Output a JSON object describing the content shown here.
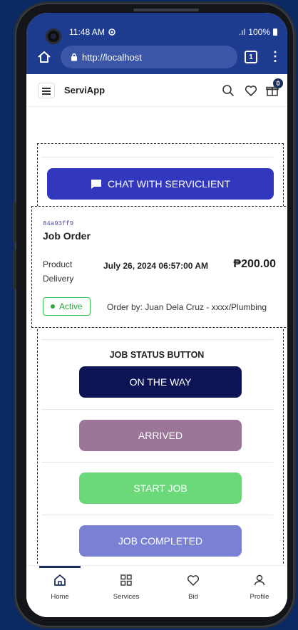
{
  "status_bar": {
    "time": "11:48 AM",
    "signal": ".ıl",
    "battery": "100%"
  },
  "browser": {
    "url": "http://localhost",
    "tab_count": "1"
  },
  "app": {
    "name": "ServiApp",
    "cart_count": "0"
  },
  "chat_button": {
    "label": "CHAT WITH SERVICLIENT"
  },
  "order": {
    "id": "84a93ff9",
    "title": "Job Order",
    "label_product": "Product",
    "label_delivery": "Delivery",
    "date": "July 26, 2024 06:57:00 AM",
    "price": "₱200.00",
    "status": "Active",
    "ordered_by": "Order by: Juan Dela Cruz - xxxx/Plumbing"
  },
  "job_status": {
    "title": "JOB STATUS BUTTON",
    "buttons": [
      {
        "label": "ON THE WAY",
        "color": "#0d1456"
      },
      {
        "label": "ARRIVED",
        "color": "#9c7698"
      },
      {
        "label": "START JOB",
        "color": "#6bd97a"
      },
      {
        "label": "JOB COMPLETED",
        "color": "#7a80d4"
      }
    ]
  },
  "nav": {
    "items": [
      {
        "label": "Home",
        "icon": "home-icon"
      },
      {
        "label": "Services",
        "icon": "grid-icon"
      },
      {
        "label": "Bid",
        "icon": "heart-icon"
      },
      {
        "label": "Profile",
        "icon": "user-icon"
      }
    ]
  },
  "colors": {
    "browser_bar": "#1e3c8f",
    "chat": "#3138be",
    "active": "#2fa63f",
    "nav_active": "#1b2d5a"
  }
}
